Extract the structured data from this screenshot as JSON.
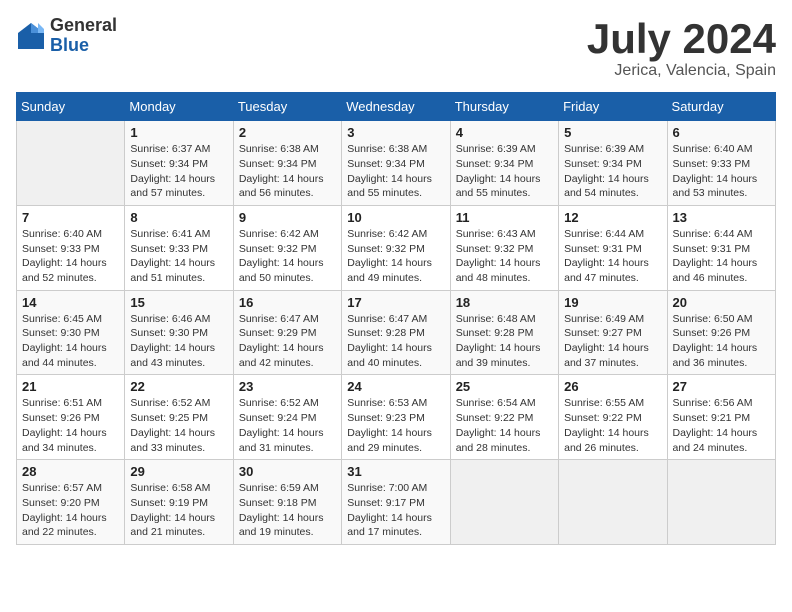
{
  "header": {
    "logo_general": "General",
    "logo_blue": "Blue",
    "month_title": "July 2024",
    "location": "Jerica, Valencia, Spain"
  },
  "weekdays": [
    "Sunday",
    "Monday",
    "Tuesday",
    "Wednesday",
    "Thursday",
    "Friday",
    "Saturday"
  ],
  "weeks": [
    [
      {
        "day": "",
        "empty": true
      },
      {
        "day": "1",
        "sunrise": "Sunrise: 6:37 AM",
        "sunset": "Sunset: 9:34 PM",
        "daylight": "Daylight: 14 hours and 57 minutes."
      },
      {
        "day": "2",
        "sunrise": "Sunrise: 6:38 AM",
        "sunset": "Sunset: 9:34 PM",
        "daylight": "Daylight: 14 hours and 56 minutes."
      },
      {
        "day": "3",
        "sunrise": "Sunrise: 6:38 AM",
        "sunset": "Sunset: 9:34 PM",
        "daylight": "Daylight: 14 hours and 55 minutes."
      },
      {
        "day": "4",
        "sunrise": "Sunrise: 6:39 AM",
        "sunset": "Sunset: 9:34 PM",
        "daylight": "Daylight: 14 hours and 55 minutes."
      },
      {
        "day": "5",
        "sunrise": "Sunrise: 6:39 AM",
        "sunset": "Sunset: 9:34 PM",
        "daylight": "Daylight: 14 hours and 54 minutes."
      },
      {
        "day": "6",
        "sunrise": "Sunrise: 6:40 AM",
        "sunset": "Sunset: 9:33 PM",
        "daylight": "Daylight: 14 hours and 53 minutes."
      }
    ],
    [
      {
        "day": "7",
        "sunrise": "Sunrise: 6:40 AM",
        "sunset": "Sunset: 9:33 PM",
        "daylight": "Daylight: 14 hours and 52 minutes."
      },
      {
        "day": "8",
        "sunrise": "Sunrise: 6:41 AM",
        "sunset": "Sunset: 9:33 PM",
        "daylight": "Daylight: 14 hours and 51 minutes."
      },
      {
        "day": "9",
        "sunrise": "Sunrise: 6:42 AM",
        "sunset": "Sunset: 9:32 PM",
        "daylight": "Daylight: 14 hours and 50 minutes."
      },
      {
        "day": "10",
        "sunrise": "Sunrise: 6:42 AM",
        "sunset": "Sunset: 9:32 PM",
        "daylight": "Daylight: 14 hours and 49 minutes."
      },
      {
        "day": "11",
        "sunrise": "Sunrise: 6:43 AM",
        "sunset": "Sunset: 9:32 PM",
        "daylight": "Daylight: 14 hours and 48 minutes."
      },
      {
        "day": "12",
        "sunrise": "Sunrise: 6:44 AM",
        "sunset": "Sunset: 9:31 PM",
        "daylight": "Daylight: 14 hours and 47 minutes."
      },
      {
        "day": "13",
        "sunrise": "Sunrise: 6:44 AM",
        "sunset": "Sunset: 9:31 PM",
        "daylight": "Daylight: 14 hours and 46 minutes."
      }
    ],
    [
      {
        "day": "14",
        "sunrise": "Sunrise: 6:45 AM",
        "sunset": "Sunset: 9:30 PM",
        "daylight": "Daylight: 14 hours and 44 minutes."
      },
      {
        "day": "15",
        "sunrise": "Sunrise: 6:46 AM",
        "sunset": "Sunset: 9:30 PM",
        "daylight": "Daylight: 14 hours and 43 minutes."
      },
      {
        "day": "16",
        "sunrise": "Sunrise: 6:47 AM",
        "sunset": "Sunset: 9:29 PM",
        "daylight": "Daylight: 14 hours and 42 minutes."
      },
      {
        "day": "17",
        "sunrise": "Sunrise: 6:47 AM",
        "sunset": "Sunset: 9:28 PM",
        "daylight": "Daylight: 14 hours and 40 minutes."
      },
      {
        "day": "18",
        "sunrise": "Sunrise: 6:48 AM",
        "sunset": "Sunset: 9:28 PM",
        "daylight": "Daylight: 14 hours and 39 minutes."
      },
      {
        "day": "19",
        "sunrise": "Sunrise: 6:49 AM",
        "sunset": "Sunset: 9:27 PM",
        "daylight": "Daylight: 14 hours and 37 minutes."
      },
      {
        "day": "20",
        "sunrise": "Sunrise: 6:50 AM",
        "sunset": "Sunset: 9:26 PM",
        "daylight": "Daylight: 14 hours and 36 minutes."
      }
    ],
    [
      {
        "day": "21",
        "sunrise": "Sunrise: 6:51 AM",
        "sunset": "Sunset: 9:26 PM",
        "daylight": "Daylight: 14 hours and 34 minutes."
      },
      {
        "day": "22",
        "sunrise": "Sunrise: 6:52 AM",
        "sunset": "Sunset: 9:25 PM",
        "daylight": "Daylight: 14 hours and 33 minutes."
      },
      {
        "day": "23",
        "sunrise": "Sunrise: 6:52 AM",
        "sunset": "Sunset: 9:24 PM",
        "daylight": "Daylight: 14 hours and 31 minutes."
      },
      {
        "day": "24",
        "sunrise": "Sunrise: 6:53 AM",
        "sunset": "Sunset: 9:23 PM",
        "daylight": "Daylight: 14 hours and 29 minutes."
      },
      {
        "day": "25",
        "sunrise": "Sunrise: 6:54 AM",
        "sunset": "Sunset: 9:22 PM",
        "daylight": "Daylight: 14 hours and 28 minutes."
      },
      {
        "day": "26",
        "sunrise": "Sunrise: 6:55 AM",
        "sunset": "Sunset: 9:22 PM",
        "daylight": "Daylight: 14 hours and 26 minutes."
      },
      {
        "day": "27",
        "sunrise": "Sunrise: 6:56 AM",
        "sunset": "Sunset: 9:21 PM",
        "daylight": "Daylight: 14 hours and 24 minutes."
      }
    ],
    [
      {
        "day": "28",
        "sunrise": "Sunrise: 6:57 AM",
        "sunset": "Sunset: 9:20 PM",
        "daylight": "Daylight: 14 hours and 22 minutes."
      },
      {
        "day": "29",
        "sunrise": "Sunrise: 6:58 AM",
        "sunset": "Sunset: 9:19 PM",
        "daylight": "Daylight: 14 hours and 21 minutes."
      },
      {
        "day": "30",
        "sunrise": "Sunrise: 6:59 AM",
        "sunset": "Sunset: 9:18 PM",
        "daylight": "Daylight: 14 hours and 19 minutes."
      },
      {
        "day": "31",
        "sunrise": "Sunrise: 7:00 AM",
        "sunset": "Sunset: 9:17 PM",
        "daylight": "Daylight: 14 hours and 17 minutes."
      },
      {
        "day": "",
        "empty": true
      },
      {
        "day": "",
        "empty": true
      },
      {
        "day": "",
        "empty": true
      }
    ]
  ]
}
